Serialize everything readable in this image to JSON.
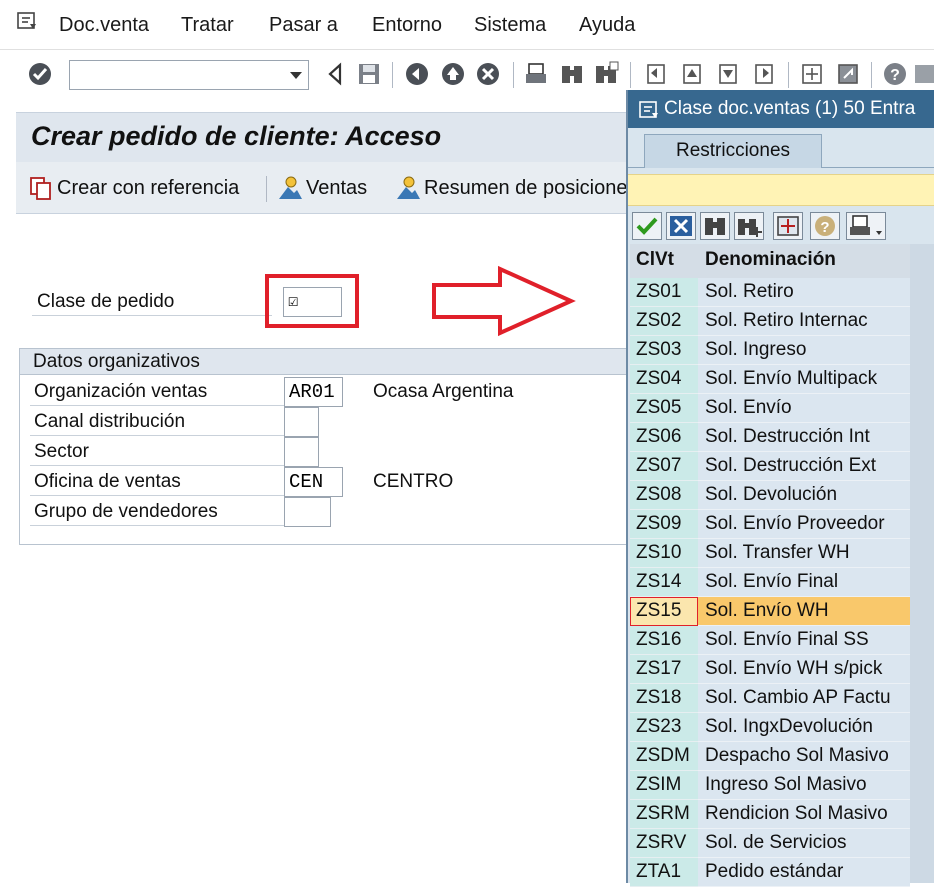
{
  "menu": {
    "items": [
      "Doc.venta",
      "Tratar",
      "Pasar a",
      "Entorno",
      "Sistema",
      "Ayuda"
    ]
  },
  "toolbar": {
    "command_value": "",
    "icons": [
      "enter-icon",
      "back-icon",
      "save-icon",
      "back-nav-icon",
      "exit-icon",
      "cancel-icon",
      "print-icon",
      "find-icon",
      "find-next-icon",
      "first-page-icon",
      "prev-page-icon",
      "next-page-icon",
      "last-page-icon",
      "new-session-icon",
      "shortcut-icon",
      "help-icon",
      "layout-icon"
    ]
  },
  "main": {
    "title": "Crear pedido de cliente: Acceso",
    "app_toolbar": {
      "create_ref": "Crear con referencia",
      "ventas": "Ventas",
      "resumen": "Resumen de posiciones"
    },
    "clase_pedido_label": "Clase de pedido",
    "clase_pedido_value": "☑",
    "org": {
      "title": "Datos organizativos",
      "fields": [
        {
          "label": "Organización ventas",
          "value": "AR01",
          "desc": "Ocasa Argentina"
        },
        {
          "label": "Canal distribución",
          "value": "",
          "desc": ""
        },
        {
          "label": "Sector",
          "value": "",
          "desc": ""
        },
        {
          "label": "Oficina de ventas",
          "value": "CEN",
          "desc": "CENTRO"
        },
        {
          "label": "Grupo de vendedores",
          "value": "",
          "desc": ""
        }
      ]
    }
  },
  "popup": {
    "title": "Clase doc.ventas (1)   50 Entra",
    "tab": "Restricciones",
    "col_code": "ClVt",
    "col_name": "Denominación",
    "selected_index": 11,
    "rows": [
      {
        "code": "ZS01",
        "name": "Sol. Retiro"
      },
      {
        "code": "ZS02",
        "name": "Sol. Retiro Internac"
      },
      {
        "code": "ZS03",
        "name": "Sol. Ingreso"
      },
      {
        "code": "ZS04",
        "name": "Sol. Envío Multipack"
      },
      {
        "code": "ZS05",
        "name": "Sol. Envío"
      },
      {
        "code": "ZS06",
        "name": "Sol. Destrucción Int"
      },
      {
        "code": "ZS07",
        "name": "Sol. Destrucción Ext"
      },
      {
        "code": "ZS08",
        "name": "Sol. Devolución"
      },
      {
        "code": "ZS09",
        "name": "Sol. Envío Proveedor"
      },
      {
        "code": "ZS10",
        "name": "Sol. Transfer WH"
      },
      {
        "code": "ZS14",
        "name": "Sol. Envío Final"
      },
      {
        "code": "ZS15",
        "name": "Sol. Envío WH"
      },
      {
        "code": "ZS16",
        "name": "Sol. Envío Final SS"
      },
      {
        "code": "ZS17",
        "name": "Sol. Envío WH s/pick"
      },
      {
        "code": "ZS18",
        "name": "Sol. Cambio AP Factu"
      },
      {
        "code": "ZS23",
        "name": "Sol. IngxDevolución"
      },
      {
        "code": "ZSDM",
        "name": "Despacho Sol Masivo"
      },
      {
        "code": "ZSIM",
        "name": "Ingreso Sol Masivo"
      },
      {
        "code": "ZSRM",
        "name": "Rendicion Sol Masivo"
      },
      {
        "code": "ZSRV",
        "name": "Sol. de Servicios"
      },
      {
        "code": "ZTA1",
        "name": "Pedido estándar"
      }
    ]
  }
}
